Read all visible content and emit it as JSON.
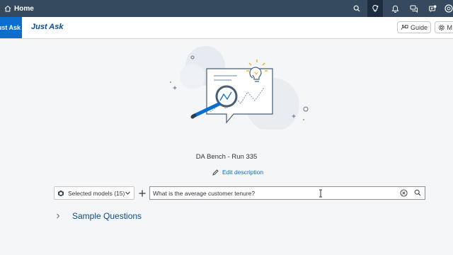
{
  "topbar": {
    "home_label": "Home",
    "icons": [
      "search-icon",
      "lightbulb-icon",
      "bell-icon",
      "chat-icon",
      "messages-icon",
      "account-icon"
    ]
  },
  "app": {
    "tag_label": "Just Ask",
    "title": "Just Ask",
    "guide_label": "Guide",
    "more_label": "M"
  },
  "main": {
    "run_title": "DA Bench - Run 335",
    "edit_label": "Edit description",
    "models_label": "Selected models (15)",
    "query_value": "What is the average customer tenure?",
    "sample_label": "Sample Questions"
  },
  "colors": {
    "shell": "#354a5f",
    "accent": "#0a6ed1",
    "title": "#0a4a8f",
    "background": "#f5f6f7"
  }
}
